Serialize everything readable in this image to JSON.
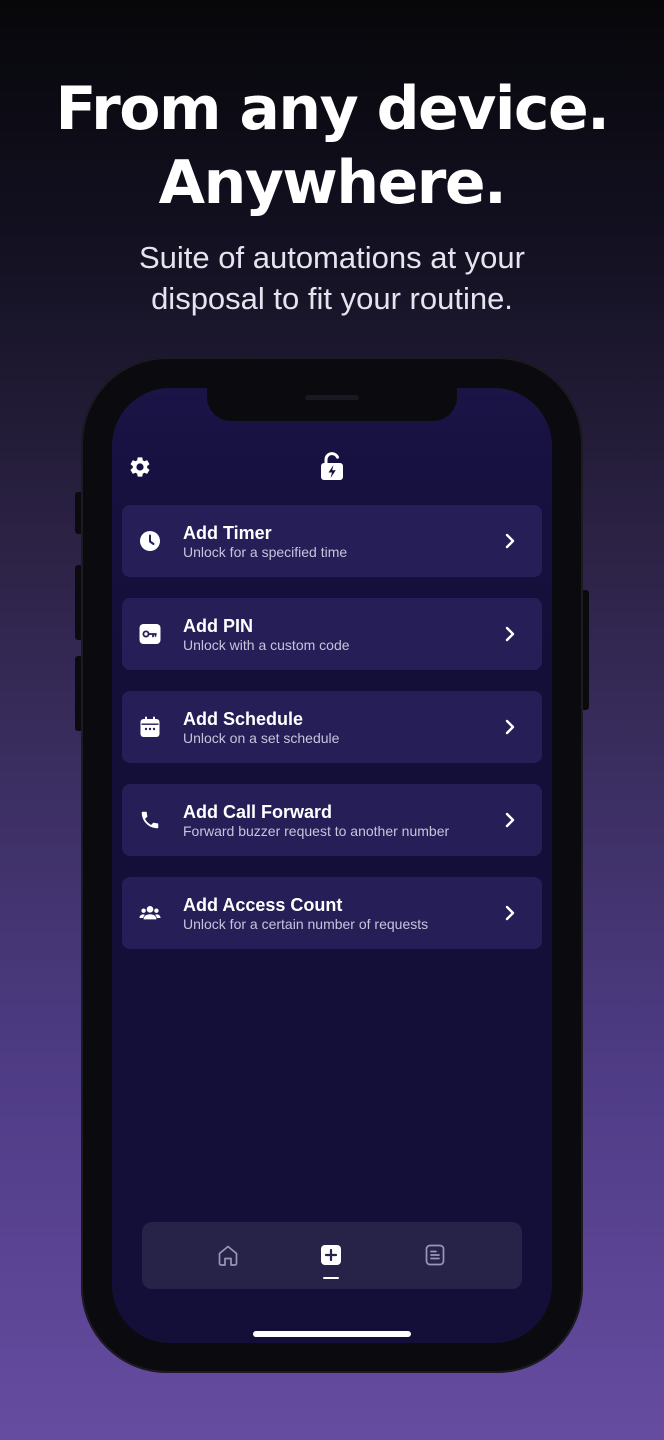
{
  "hero": {
    "title_line1": "From any device.",
    "title_line2": "Anywhere.",
    "subtitle_line1": "Suite of automations at your",
    "subtitle_line2": "disposal to fit your routine."
  },
  "app": {
    "header": {
      "settings_icon": "gear-icon",
      "logo_icon": "unlocked-padlock-bolt-icon"
    },
    "actions": [
      {
        "title": "Add Timer",
        "subtitle": "Unlock for a specified time",
        "icon": "clock-icon"
      },
      {
        "title": "Add PIN",
        "subtitle": "Unlock with a custom code",
        "icon": "key-icon"
      },
      {
        "title": "Add Schedule",
        "subtitle": "Unlock on a set schedule",
        "icon": "calendar-icon"
      },
      {
        "title": "Add Call Forward",
        "subtitle": "Forward buzzer request to another number",
        "icon": "phone-icon"
      },
      {
        "title": "Add Access Count",
        "subtitle": "Unlock for a certain number of requests",
        "icon": "users-icon"
      }
    ],
    "tabbar": {
      "tabs": [
        {
          "icon": "home-icon",
          "active": false
        },
        {
          "icon": "plus-square-icon",
          "active": true
        },
        {
          "icon": "document-list-icon",
          "active": false
        }
      ]
    },
    "colors": {
      "screen_bg": "#140f38",
      "card_bg": "#251e57",
      "tabbar_bg": "#272248",
      "subtitle_text": "#c8c4dc"
    }
  }
}
